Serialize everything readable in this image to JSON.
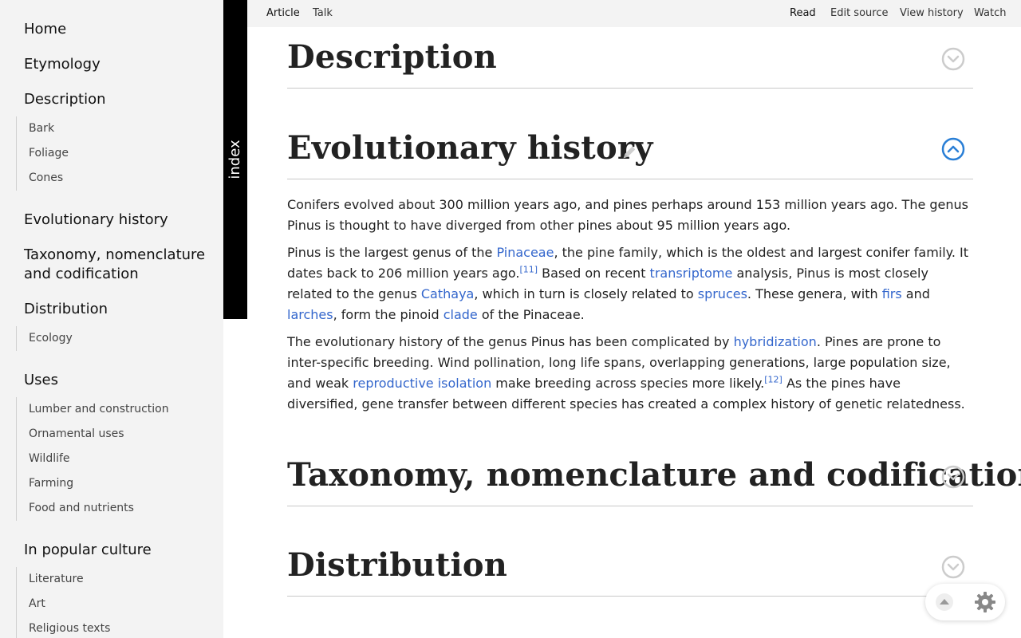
{
  "sidebar": {
    "home": "Home",
    "etymology": "Etymology",
    "description": "Description",
    "description_items": [
      "Bark",
      "Foliage",
      "Cones"
    ],
    "evolutionary_history": "Evolutionary history",
    "taxonomy": "Taxonomy, nomenclature and codification",
    "distribution": "Distribution",
    "distribution_items": [
      "Ecology"
    ],
    "uses": "Uses",
    "uses_items": [
      "Lumber and construction",
      "Ornamental uses",
      "Wildlife",
      "Farming",
      "Food and nutrients"
    ],
    "popular_culture": "In popular culture",
    "popular_culture_items": [
      "Literature",
      "Art",
      "Religious texts"
    ]
  },
  "index_tab": {
    "label": "index"
  },
  "topbar": {
    "article": "Article",
    "talk": "Talk",
    "read": "Read",
    "edit_source": "Edit source",
    "view_history": "View history",
    "watch": "Watch"
  },
  "sections": {
    "description": {
      "title": "Description",
      "expanded": false
    },
    "evolutionary_history": {
      "title": "Evolutionary history",
      "expanded": true
    },
    "taxonomy": {
      "title": "Taxonomy, nomenclature and codification",
      "expanded": false
    },
    "distribution": {
      "title": "Distribution",
      "expanded": false
    }
  },
  "evolution_text": {
    "p1": "Conifers evolved about 300 million years ago, and pines perhaps around 153 million years ago. The genus Pinus is thought to have diverged from other pines about 95 million years ago.",
    "p2": {
      "t1": "Pinus is the largest genus of the ",
      "l1": "Pinaceae",
      "t2": ", the pine family, which is the oldest and largest conifer family. It dates back to 206 million years ago.",
      "ref1": "[11]",
      "t3": " Based on recent ",
      "l2": "transriptome",
      "t4": " analysis, Pinus is most closely related to the genus ",
      "l3": "Cathaya",
      "t5": ", which in turn is closely related to ",
      "l4": "spruces",
      "t6": ". These genera, with ",
      "l5": "firs",
      "t7": " and ",
      "l6": "larches",
      "t8": ", form the pinoid ",
      "l7": "clade",
      "t9": " of the Pinaceae."
    },
    "p3": {
      "t1": "The evolutionary history of the genus Pinus has been complicated by ",
      "l1": "hybridization",
      "t2": ". Pines are prone to inter-specific breeding. Wind pollination, long life spans, overlapping generations, large population size, and weak ",
      "l2": "reproductive isolation",
      "t3": " make breeding across species more likely.",
      "ref1": "[12]",
      "t4": " As the pines have diversified, gene transfer between different species has created a complex history of genetic relatedness."
    }
  },
  "icons": {
    "collapsed_chevron": "chevron-down-circle-icon",
    "expanded_chevron": "chevron-up-circle-icon",
    "edit": "pencil-icon",
    "scroll_top": "arrow-up-icon",
    "settings": "gear-icon"
  },
  "colors": {
    "link": "#3366cc",
    "expanded_accent": "#2a7fd6",
    "collapsed_icon": "#cccccc",
    "sidebar_bg": "#f3f3f3",
    "index_tab_bg": "#000000"
  }
}
